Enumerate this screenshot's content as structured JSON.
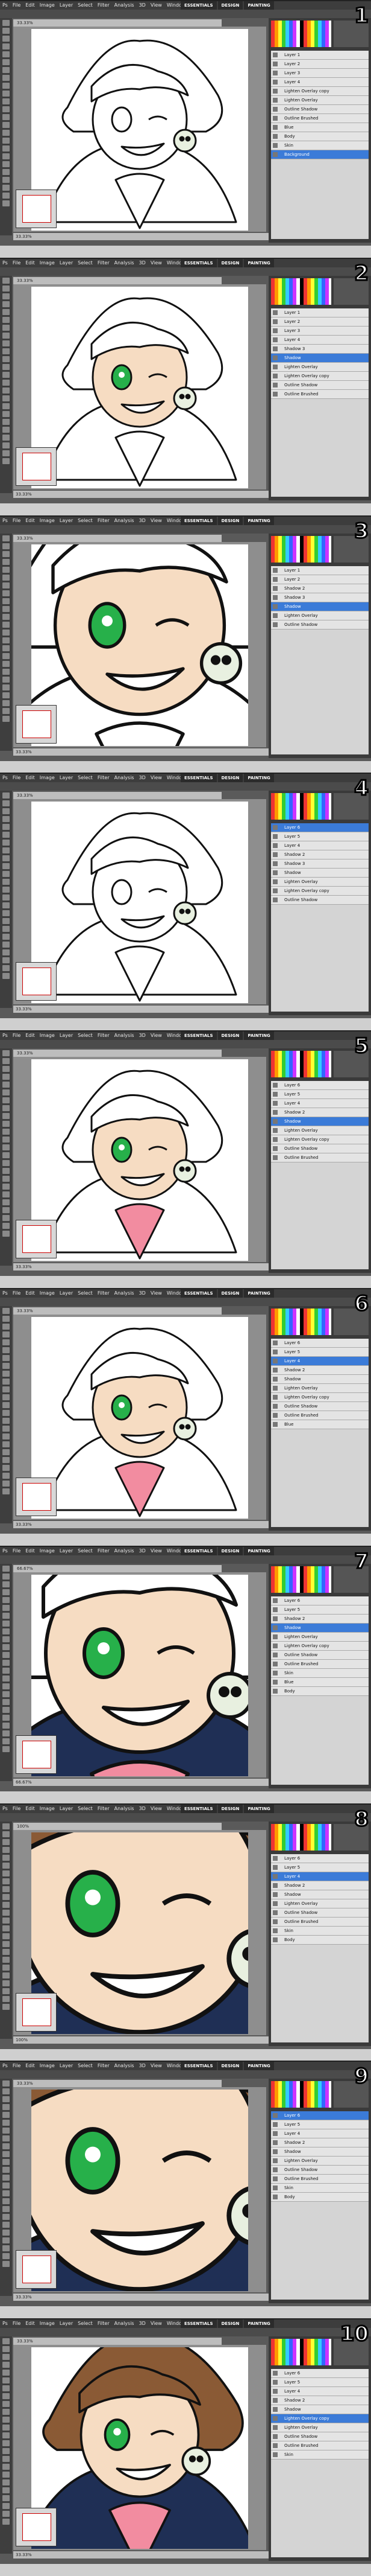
{
  "menu": [
    "Ps",
    "File",
    "Edit",
    "Image",
    "Layer",
    "Select",
    "Filter",
    "Analysis",
    "3D",
    "View",
    "Window",
    "Help"
  ],
  "workspace": [
    "ESSENTIALS",
    "DESIGN",
    "PAINTING"
  ],
  "panels": [
    {
      "num": "1",
      "status": "33.33%",
      "active": "Background",
      "layers": [
        "Layer 1",
        "Layer 2",
        "Layer 3",
        "Layer 4",
        "Lighten Overlay copy",
        "Lighten Overlay",
        "Outline Shadow",
        "Outline Brushed",
        "Blue",
        "Body",
        "Skin",
        "Background"
      ]
    },
    {
      "num": "2",
      "status": "33.33%",
      "active": "Shadow",
      "layers": [
        "Layer 1",
        "Layer 2",
        "Layer 3",
        "Layer 4",
        "Shadow 3",
        "Shadow",
        "Lighten Overlay",
        "Lighten Overlay copy",
        "Outline Shadow",
        "Outline Brushed"
      ]
    },
    {
      "num": "3",
      "status": "33.33%",
      "active": "Shadow",
      "layers": [
        "Layer 1",
        "Layer 2",
        "Shadow 2",
        "Shadow 3",
        "Shadow",
        "Lighten Overlay",
        "Outline Shadow"
      ]
    },
    {
      "num": "4",
      "status": "33.33%",
      "active": "Layer 6",
      "layers": [
        "Layer 6",
        "Layer 5",
        "Layer 4",
        "Shadow 2",
        "Shadow 3",
        "Shadow",
        "Lighten Overlay",
        "Lighten Overlay copy",
        "Outline Shadow"
      ]
    },
    {
      "num": "5",
      "status": "33.33%",
      "active": "Shadow",
      "layers": [
        "Layer 6",
        "Layer 5",
        "Layer 4",
        "Shadow 2",
        "Shadow",
        "Lighten Overlay",
        "Lighten Overlay copy",
        "Outline Shadow",
        "Outline Brushed"
      ]
    },
    {
      "num": "6",
      "status": "33.33%",
      "active": "Layer 4",
      "layers": [
        "Layer 6",
        "Layer 5",
        "Layer 4",
        "Shadow 2",
        "Shadow",
        "Lighten Overlay",
        "Lighten Overlay copy",
        "Outline Shadow",
        "Outline Brushed",
        "Blue"
      ]
    },
    {
      "num": "7",
      "status": "66.67%",
      "active": "Shadow",
      "layers": [
        "Layer 6",
        "Layer 5",
        "Shadow 2",
        "Shadow",
        "Lighten Overlay",
        "Lighten Overlay copy",
        "Outline Shadow",
        "Outline Brushed",
        "Skin",
        "Blue",
        "Body"
      ]
    },
    {
      "num": "8",
      "status": "100%",
      "active": "Layer 4",
      "layers": [
        "Layer 6",
        "Layer 5",
        "Layer 4",
        "Shadow 2",
        "Shadow",
        "Lighten Overlay",
        "Outline Shadow",
        "Outline Brushed",
        "Skin",
        "Body"
      ]
    },
    {
      "num": "9",
      "status": "33.33%",
      "active": "Layer 6",
      "layers": [
        "Layer 6",
        "Layer 5",
        "Layer 4",
        "Shadow 2",
        "Shadow",
        "Lighten Overlay",
        "Outline Shadow",
        "Outline Brushed",
        "Skin",
        "Body"
      ]
    },
    {
      "num": "10",
      "status": "33.33%",
      "active": "Lighten Overlay copy",
      "layers": [
        "Layer 6",
        "Layer 5",
        "Layer 4",
        "Shadow 2",
        "Shadow",
        "Lighten Overlay copy",
        "Lighten Overlay",
        "Outline Shadow",
        "Outline Brushed",
        "Skin"
      ]
    }
  ],
  "stages": [
    "lineart",
    "green-eyes",
    "closeup",
    "lineart",
    "pink",
    "pink",
    "navy",
    "brown",
    "brown",
    "full"
  ]
}
